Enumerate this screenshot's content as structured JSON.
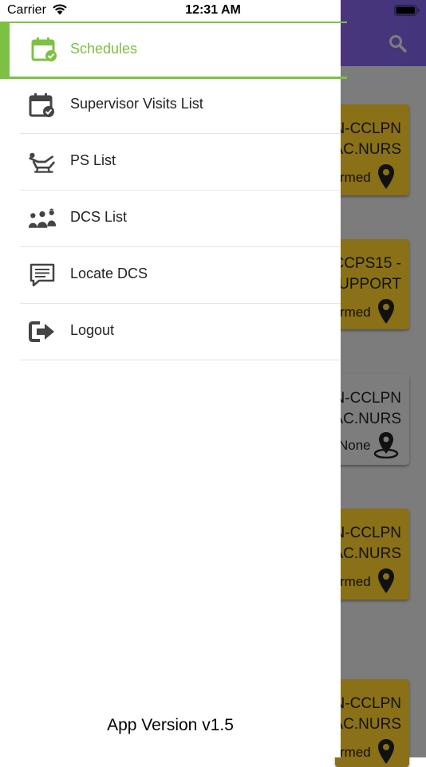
{
  "status_bar": {
    "carrier": "Carrier",
    "time": "12:31 AM"
  },
  "menu": {
    "items": [
      {
        "label": "Schedules",
        "icon": "calendar-check-icon",
        "active": true
      },
      {
        "label": "Supervisor Visits List",
        "icon": "calendar-check-icon"
      },
      {
        "label": "PS List",
        "icon": "patient-chair-icon"
      },
      {
        "label": "DCS List",
        "icon": "staff-group-icon"
      },
      {
        "label": "Locate DCS",
        "icon": "chat-bubble-icon"
      },
      {
        "label": "Logout",
        "icon": "logout-icon"
      }
    ]
  },
  "footer": {
    "version": "App Version v1.5"
  },
  "background_cards": [
    {
      "line1": "N-CCLPN",
      "line2": "AC.NURS",
      "status": "rmed",
      "color": "yellow"
    },
    {
      "line1": "CCPS15 -",
      "line2": "UPPORT",
      "status": "rmed",
      "color": "yellow"
    },
    {
      "line1": "N-CCLPN",
      "line2": "AC.NURS",
      "status": "None",
      "color": "grey"
    },
    {
      "line1": "N-CCLPN",
      "line2": "AC.NURS",
      "status": "rmed",
      "color": "yellow"
    },
    {
      "line1": "N-CCLPN",
      "line2": "AC.NURS",
      "status": "rmed",
      "color": "yellow"
    }
  ],
  "colors": {
    "accent": "#7cc144",
    "header": "#8a5dc8",
    "card_yellow": "#e2b626"
  }
}
